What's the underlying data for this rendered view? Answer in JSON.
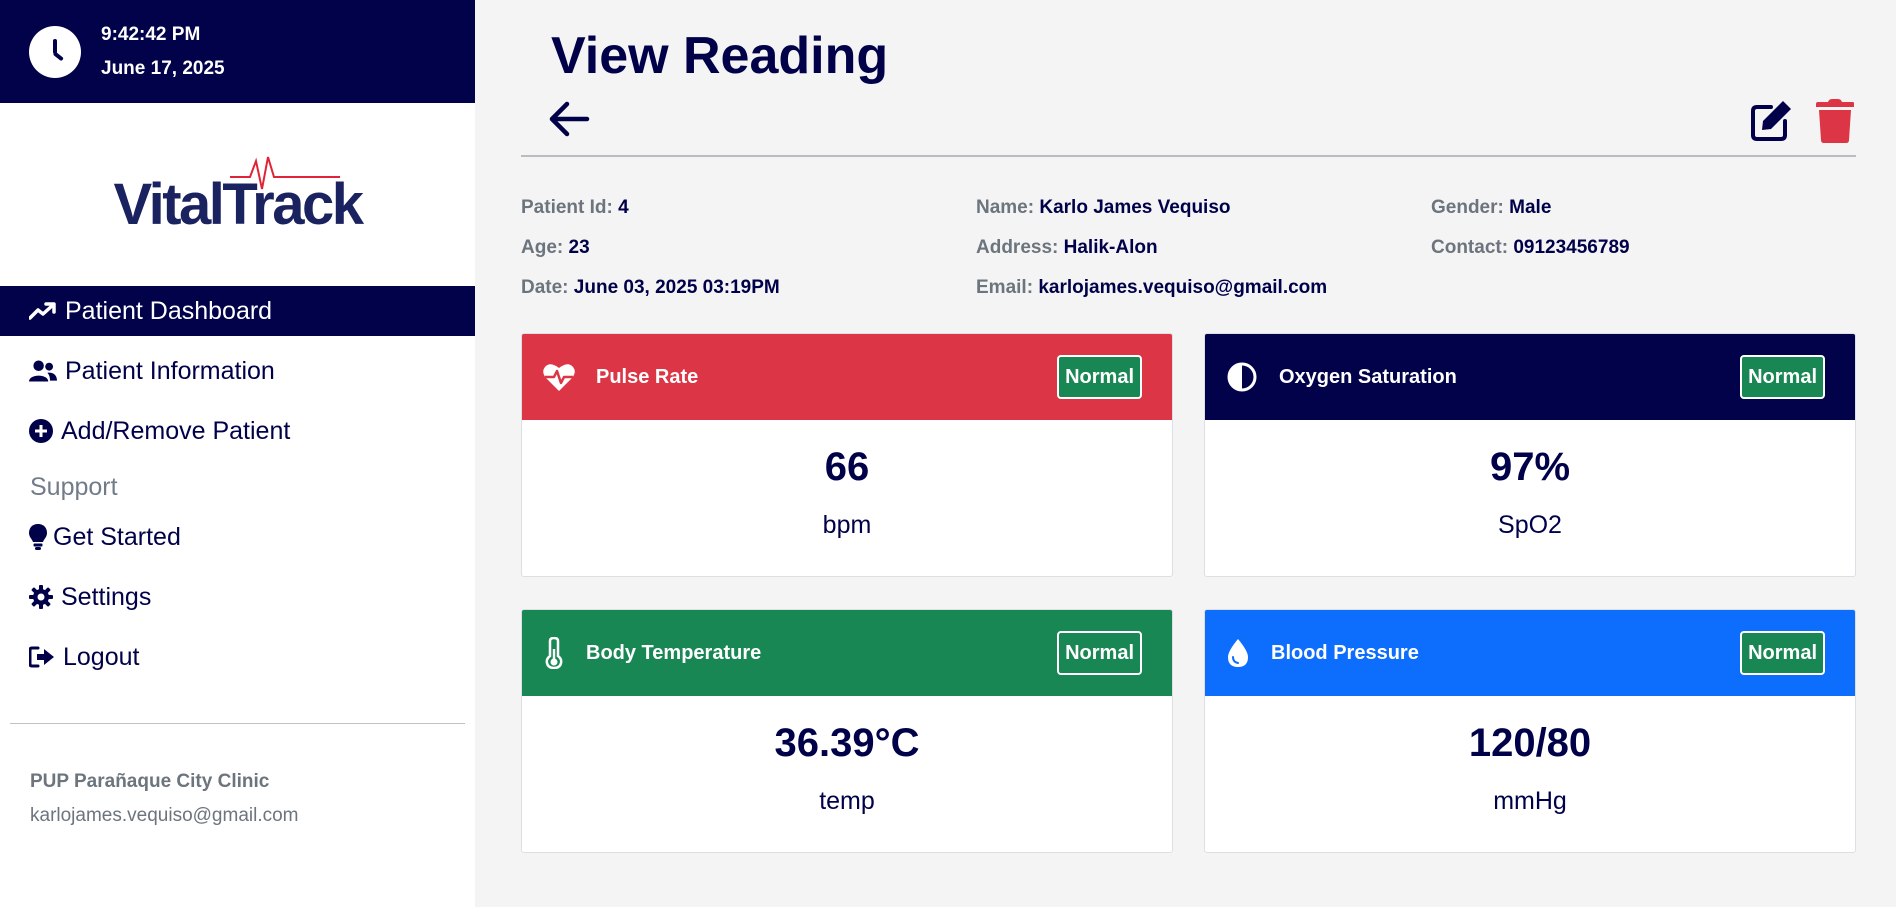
{
  "clock": {
    "time": "9:42:42 PM",
    "date": "June 17, 2025"
  },
  "logo": {
    "text": "VitalTrack"
  },
  "nav": {
    "items": [
      {
        "label": "Patient Dashboard",
        "icon": "trend-up-icon",
        "active": true
      },
      {
        "label": "Patient Information",
        "icon": "users-icon",
        "active": false
      },
      {
        "label": "Add/Remove Patient",
        "icon": "plus-circle-icon",
        "active": false
      }
    ],
    "support_label": "Support",
    "support_items": [
      {
        "label": "Get Started",
        "icon": "lightbulb-icon"
      },
      {
        "label": "Settings",
        "icon": "gear-icon"
      },
      {
        "label": "Logout",
        "icon": "logout-icon"
      }
    ]
  },
  "clinic": {
    "name": "PUP Parañaque City Clinic",
    "email": "karlojames.vequiso@gmail.com"
  },
  "page": {
    "title": "View Reading"
  },
  "patient": {
    "id_label": "Patient Id:",
    "id": "4",
    "name_label": "Name:",
    "name": "Karlo James Vequiso",
    "gender_label": "Gender:",
    "gender": "Male",
    "age_label": "Age:",
    "age": "23",
    "address_label": "Address:",
    "address": "Halik-Alon",
    "contact_label": "Contact:",
    "contact": "09123456789",
    "date_label": "Date:",
    "date": "June 03, 2025 03:19PM",
    "email_label": "Email:",
    "email": "karlojames.vequiso@gmail.com"
  },
  "cards": {
    "pulse": {
      "title": "Pulse Rate",
      "status": "Normal",
      "value": "66",
      "unit": "bpm",
      "color": "#dc3545",
      "icon": "heartbeat-icon"
    },
    "oxygen": {
      "title": "Oxygen Saturation",
      "status": "Normal",
      "value": "97%",
      "unit": "SpO2",
      "color": "#01024a",
      "icon": "contrast-icon"
    },
    "temperature": {
      "title": "Body Temperature",
      "status": "Normal",
      "value": "36.39°C",
      "unit": "temp",
      "color": "#198754",
      "icon": "thermometer-icon"
    },
    "pressure": {
      "title": "Blood Pressure",
      "status": "Normal",
      "value": "120/80",
      "unit": "mmHg",
      "color": "#0d6efd",
      "icon": "droplet-icon"
    }
  },
  "colors": {
    "navy": "#01024a",
    "badge_green": "#198754",
    "delete_red": "#dc3545",
    "muted_gray": "#6c757d"
  }
}
